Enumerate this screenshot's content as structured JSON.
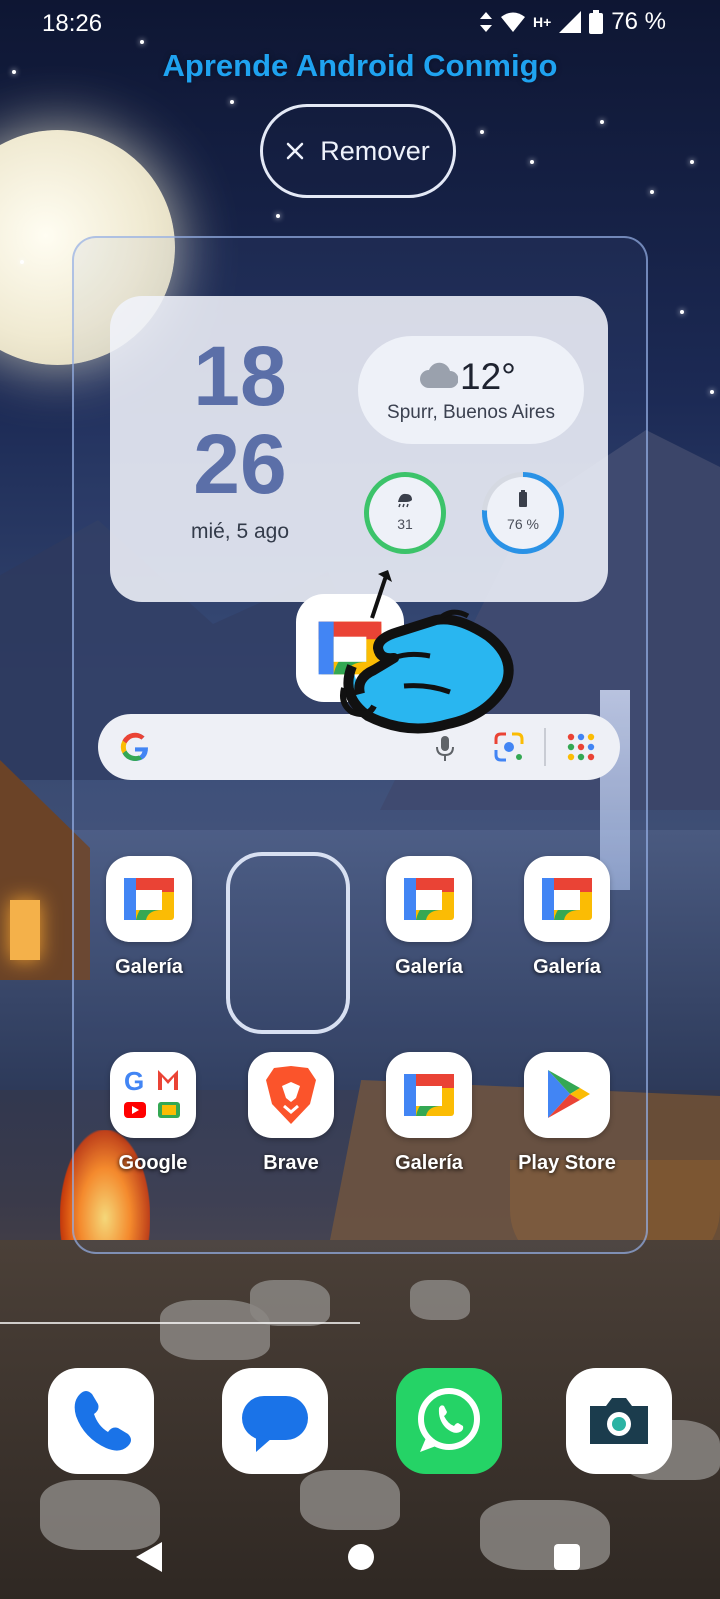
{
  "status_bar": {
    "time": "18:26",
    "network": "H+",
    "battery": "76 %"
  },
  "header": {
    "title": "Aprende Android Conmigo"
  },
  "remove_button": {
    "icon": "close-icon",
    "label": "Remover"
  },
  "widget": {
    "hour": "18",
    "minute": "26",
    "date": "mié, 5 ago",
    "weather": {
      "icon": "cloud-icon",
      "temperature": "12°",
      "location": "Spurr, Buenos Aires"
    },
    "air_quality": {
      "icon": "air-quality-icon",
      "value": "31",
      "level": 1.0,
      "color": "#3cc36a"
    },
    "battery": {
      "icon": "battery-icon",
      "value": "76 %",
      "level": 0.76,
      "color": "#2a92e6"
    }
  },
  "search_bar": {
    "logo": "google-g-icon",
    "mic": "mic-icon",
    "lens": "google-lens-icon",
    "apps": "app-grid-icon"
  },
  "apps_row1": [
    {
      "label": "Galería",
      "icon": "gallery-icon"
    },
    {
      "label": "",
      "icon": "empty-slot"
    },
    {
      "label": "Galería",
      "icon": "gallery-icon"
    },
    {
      "label": "Galería",
      "icon": "gallery-icon"
    }
  ],
  "apps_row2": [
    {
      "label": "Google",
      "icon": "google-folder-icon"
    },
    {
      "label": "Brave",
      "icon": "brave-icon"
    },
    {
      "label": "Galería",
      "icon": "gallery-icon"
    },
    {
      "label": "Play Store",
      "icon": "play-store-icon"
    }
  ],
  "dock": [
    {
      "icon": "phone-icon"
    },
    {
      "icon": "messages-icon"
    },
    {
      "icon": "whatsapp-icon"
    },
    {
      "icon": "camera-icon"
    }
  ],
  "colors": {
    "title": "#1fa3f0",
    "clock": "#5b6fa8",
    "whatsapp": "#25d366"
  }
}
